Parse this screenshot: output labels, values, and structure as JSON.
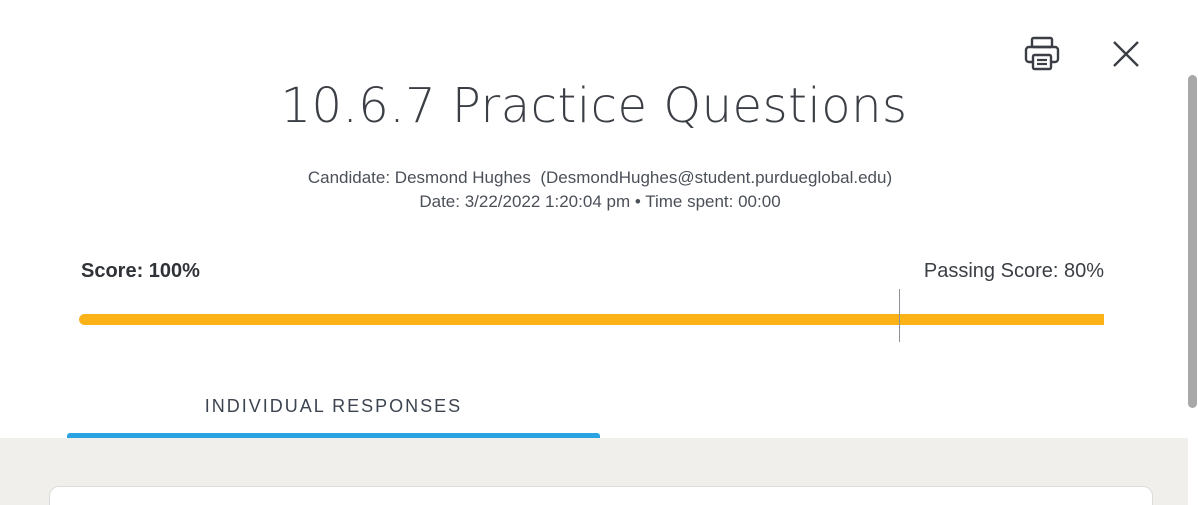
{
  "header": {
    "title": "10.6.7 Practice Questions",
    "candidate_line": "Candidate: Desmond Hughes  (DesmondHughes@student.purdueglobal.edu)",
    "date_line": "Date: 3/22/2022 1:20:04 pm • Time spent: 00:00"
  },
  "actions": {
    "print_icon": "printer-icon",
    "close_icon": "close-icon"
  },
  "score": {
    "label": "Score: 100%",
    "passing_label": "Passing Score: 80%",
    "value_percent": 100,
    "passing_percent": 80,
    "bar_color": "#fbb216"
  },
  "tabs": [
    {
      "label": "INDIVIDUAL RESPONSES",
      "active": true
    }
  ],
  "colors": {
    "accent": "#2aa3e3",
    "background_panel": "#f0efec"
  }
}
